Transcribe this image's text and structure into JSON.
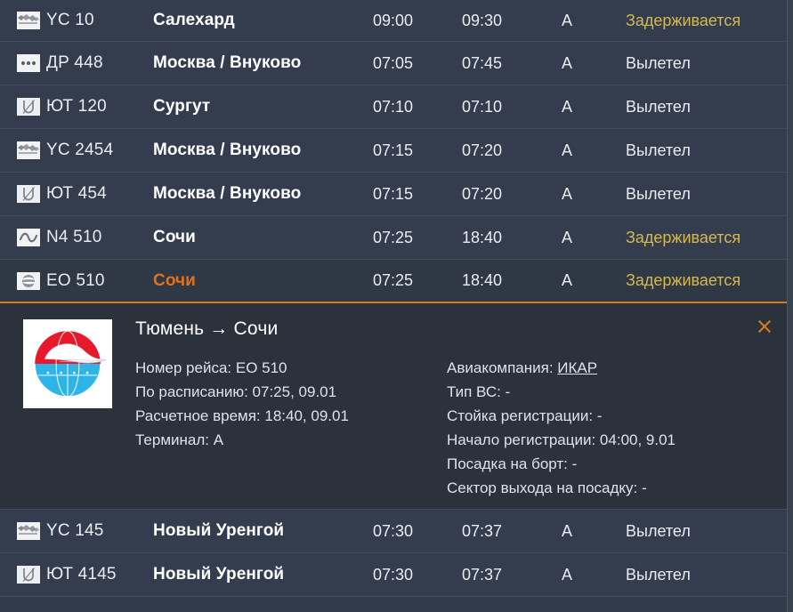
{
  "board": {
    "accent_orange": "#e2711d",
    "delayed_color": "#d7b84f",
    "row_bg": "#333d4d",
    "panel_bg": "#2b323c"
  },
  "flights": [
    {
      "logo": "yamal-icon",
      "flight": "YC 10",
      "destination": "Салехард",
      "scheduled": "09:00",
      "estimated": "09:30",
      "terminal": "A",
      "status": "Задерживается",
      "status_kind": "delayed"
    },
    {
      "logo": "dots-icon",
      "flight": "ДР 448",
      "destination": "Москва / Внуково",
      "scheduled": "07:05",
      "estimated": "07:45",
      "terminal": "A",
      "status": "Вылетел",
      "status_kind": "departed"
    },
    {
      "logo": "utair-icon",
      "flight": "ЮТ 120",
      "destination": "Сургут",
      "scheduled": "07:10",
      "estimated": "07:10",
      "terminal": "A",
      "status": "Вылетел",
      "status_kind": "departed"
    },
    {
      "logo": "yamal-icon",
      "flight": "YC 2454",
      "destination": "Москва / Внуково",
      "scheduled": "07:15",
      "estimated": "07:20",
      "terminal": "A",
      "status": "Вылетел",
      "status_kind": "departed"
    },
    {
      "logo": "utair-icon",
      "flight": "ЮТ 454",
      "destination": "Москва / Внуково",
      "scheduled": "07:15",
      "estimated": "07:20",
      "terminal": "A",
      "status": "Вылетел",
      "status_kind": "departed"
    },
    {
      "logo": "nordstar-icon",
      "flight": "N4 510",
      "destination": "Сочи",
      "scheduled": "07:25",
      "estimated": "18:40",
      "terminal": "A",
      "status": "Задерживается",
      "status_kind": "delayed"
    },
    {
      "logo": "ikar-icon",
      "flight": "EO 510",
      "destination": "Сочи",
      "scheduled": "07:25",
      "estimated": "18:40",
      "terminal": "A",
      "status": "Задерживается",
      "status_kind": "delayed",
      "selected": true
    }
  ],
  "detail": {
    "logo": "ikar-logo",
    "route": "Тюмень → Сочи",
    "close_label": "×",
    "left": [
      "Номер рейса: EO 510",
      "По расписанию: 07:25, 09.01",
      "Расчетное время: 18:40, 09.01",
      "Терминал: A"
    ],
    "right_prefix": "Авиакомпания: ",
    "right_link": "ИКАР",
    "right": [
      "Тип ВС: -",
      "Стойка регистрации: -",
      "Начало регистрации: 04:00, 9.01",
      "Посадка на борт: -",
      "Сектор выхода на посадку: -"
    ]
  },
  "flights_after": [
    {
      "logo": "yamal-icon",
      "flight": "YC 145",
      "destination": "Новый Уренгой",
      "scheduled": "07:30",
      "estimated": "07:37",
      "terminal": "A",
      "status": "Вылетел",
      "status_kind": "departed"
    },
    {
      "logo": "utair-icon",
      "flight": "ЮТ 4145",
      "destination": "Новый Уренгой",
      "scheduled": "07:30",
      "estimated": "07:37",
      "terminal": "A",
      "status": "Вылетел",
      "status_kind": "departed"
    }
  ]
}
